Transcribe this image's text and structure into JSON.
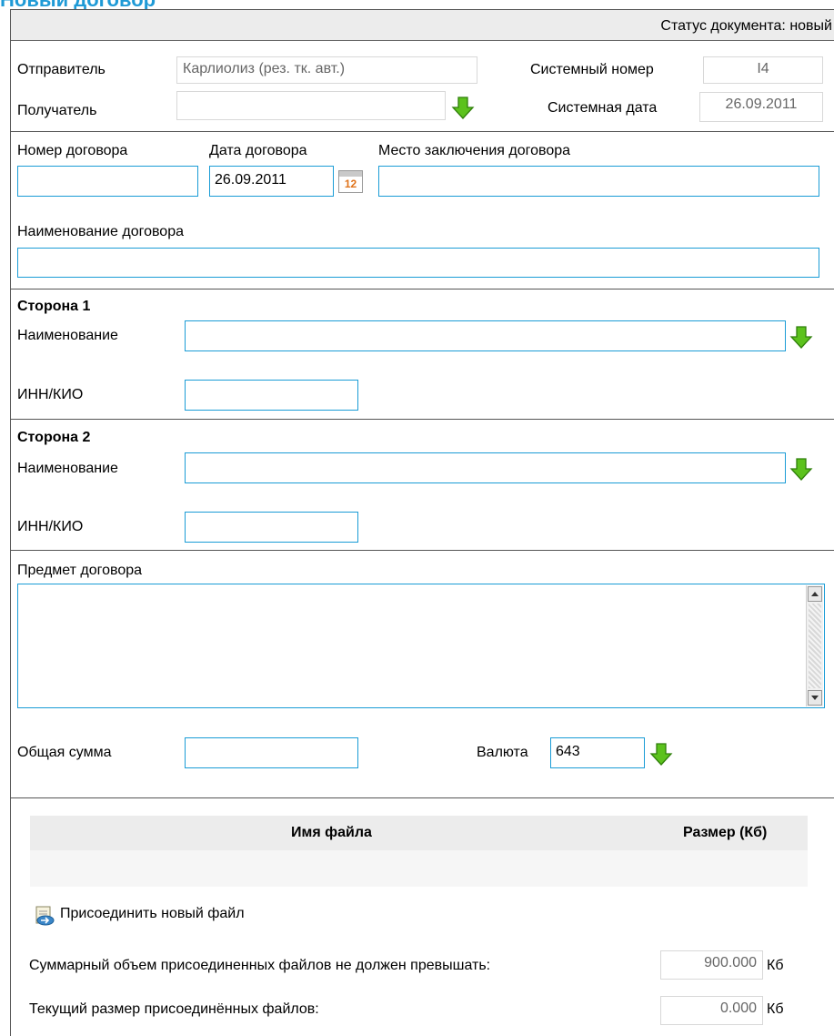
{
  "page": {
    "title": "Новый договор"
  },
  "status": {
    "label": "Статус документа: новый"
  },
  "header": {
    "sender_label": "Отправитель",
    "sender_value": "Карлиолиз (рез. тк. авт.)",
    "recipient_label": "Получатель",
    "recipient_value": "",
    "system_number_label": "Системный номер",
    "system_number_value": "I4",
    "system_date_label": "Системная дата",
    "system_date_value": "26.09.2011"
  },
  "contract": {
    "number_label": "Номер договора",
    "number_value": "",
    "date_label": "Дата договора",
    "date_value": "26.09.2011",
    "calendar_day": "12",
    "place_label": "Место заключения договора",
    "place_value": "",
    "name_label": "Наименование договора",
    "name_value": ""
  },
  "party1": {
    "heading": "Сторона 1",
    "name_label": "Наименование",
    "name_value": "",
    "inn_label": "ИНН/КИО",
    "inn_value": ""
  },
  "party2": {
    "heading": "Сторона 2",
    "name_label": "Наименование",
    "name_value": "",
    "inn_label": "ИНН/КИО",
    "inn_value": ""
  },
  "subject": {
    "label": "Предмет договора",
    "value": ""
  },
  "amount": {
    "total_label": "Общая сумма",
    "total_value": "",
    "currency_label": "Валюта",
    "currency_value": "643"
  },
  "files": {
    "col_name": "Имя файла",
    "col_size": "Размер (Кб)",
    "attach_label": "Присоединить новый файл",
    "max_label": "Суммарный объем присоединенных файлов не должен превышать:",
    "max_value": "900.000",
    "current_label": "Текущий размер присоединённых файлов:",
    "current_value": "0.000",
    "unit": "Кб"
  },
  "colors": {
    "accent": "#1a9cd6",
    "title": "#1f9ad6",
    "arrow": "#5cc21d"
  },
  "icons": {
    "lookup": "green-down-arrow-icon",
    "calendar": "calendar-icon",
    "attach": "attach-file-icon"
  }
}
